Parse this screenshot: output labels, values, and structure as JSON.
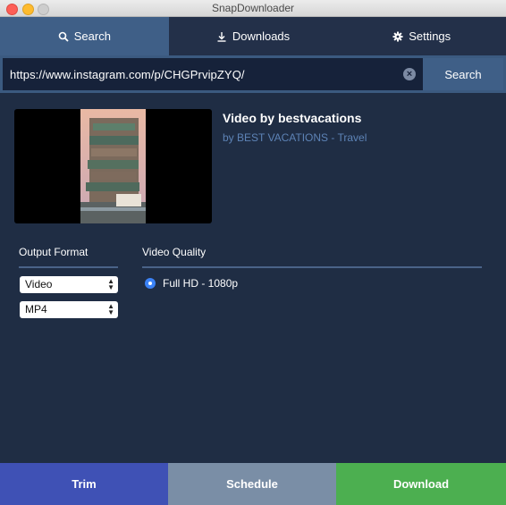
{
  "window": {
    "title": "SnapDownloader"
  },
  "tabs": [
    {
      "label": "Search",
      "icon": "search-icon"
    },
    {
      "label": "Downloads",
      "icon": "download-icon"
    },
    {
      "label": "Settings",
      "icon": "gear-icon"
    }
  ],
  "search": {
    "url": "https://www.instagram.com/p/CHGPrvipZYQ/",
    "button_label": "Search"
  },
  "video": {
    "title": "Video by bestvacations",
    "author": "by BEST VACATIONS - Travel"
  },
  "output_format": {
    "label": "Output Format",
    "format": "Video",
    "extension": "MP4"
  },
  "video_quality": {
    "label": "Video Quality",
    "selected": "Full HD - 1080p"
  },
  "actions": {
    "trim": "Trim",
    "schedule": "Schedule",
    "download": "Download"
  },
  "colors": {
    "accent": "#3f5f87",
    "trim": "#3f51b5",
    "schedule": "#7a8ea6",
    "download": "#4caf50"
  }
}
